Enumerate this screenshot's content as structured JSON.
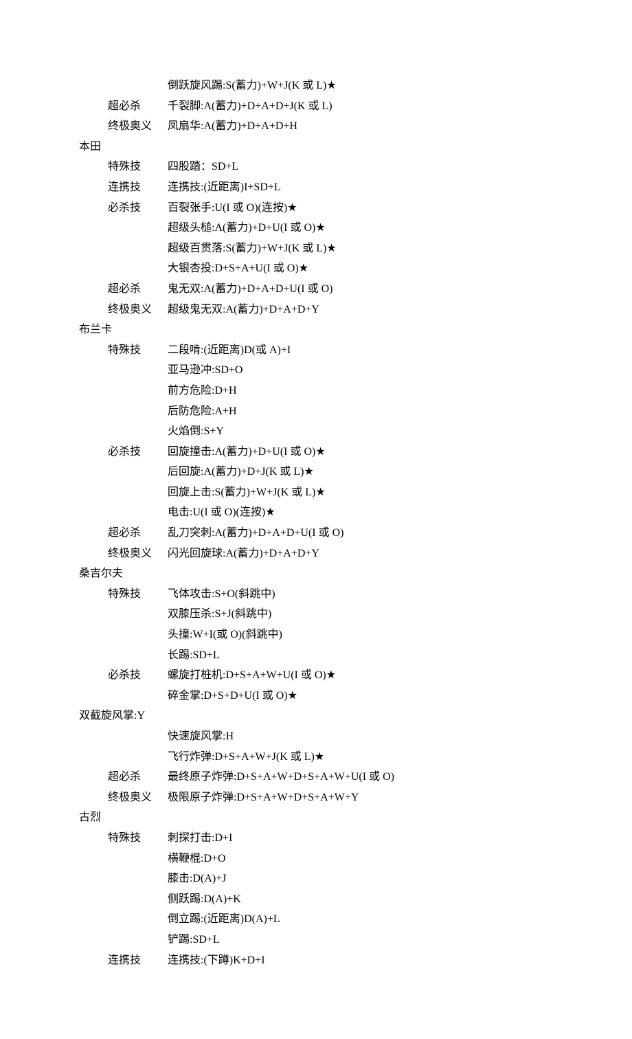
{
  "top_rows": [
    {
      "cat": "",
      "move": "倒跃旋风踢:S(蓄力)+W+J(K 或 L)★"
    },
    {
      "cat": "超必杀",
      "move": "千裂脚:A(蓄力)+D+A+D+J(K 或 L)"
    },
    {
      "cat": "终极奥义",
      "move": "凤扇华:A(蓄力)+D+A+D+H"
    }
  ],
  "characters": [
    {
      "name": "本田",
      "rows": [
        {
          "cat": "特殊技",
          "move": "四股踏：SD+L"
        },
        {
          "cat": "连携技",
          "move": "连携技:(近距离)I+SD+L"
        },
        {
          "cat": "必杀技",
          "move": "百裂张手:U(I 或 O)(连按)★"
        },
        {
          "cat": "",
          "move": "超级头槌:A(蓄力)+D+U(I 或 O)★"
        },
        {
          "cat": "",
          "move": "超级百贯落:S(蓄力)+W+J(K 或 L)★"
        },
        {
          "cat": "",
          "move": "大银杏投:D+S+A+U(I 或 O)★"
        },
        {
          "cat": "超必杀",
          "move": "鬼无双:A(蓄力)+D+A+D+U(I 或 O)"
        },
        {
          "cat": "终极奥义",
          "move": "超级鬼无双:A(蓄力)+D+A+D+Y"
        }
      ]
    },
    {
      "name": "布兰卡",
      "rows": [
        {
          "cat": "特殊技",
          "move": "二段啃:(近距离)D(或 A)+I"
        },
        {
          "cat": "",
          "move": "亚马逊冲:SD+O"
        },
        {
          "cat": "",
          "move": "前方危险:D+H"
        },
        {
          "cat": "",
          "move": "后防危险:A+H"
        },
        {
          "cat": "",
          "move": "火焰倒:S+Y"
        },
        {
          "cat": "必杀技",
          "move": "回旋撞击:A(蓄力)+D+U(I 或 O)★"
        },
        {
          "cat": "",
          "move": "后回旋:A(蓄力)+D+J(K 或 L)★"
        },
        {
          "cat": "",
          "move": "回旋上击:S(蓄力)+W+J(K 或 L)★"
        },
        {
          "cat": "",
          "move": "电击:U(I 或 O)(连按)★"
        },
        {
          "cat": "超必杀",
          "move": "乱刀突刺:A(蓄力)+D+A+D+U(I 或 O)"
        },
        {
          "cat": "终极奥义",
          "move": "闪光回旋球:A(蓄力)+D+A+D+Y"
        }
      ]
    },
    {
      "name": "桑吉尔夫",
      "rows": [
        {
          "cat": "特殊技",
          "move": "飞体攻击:S+O(斜跳中)"
        },
        {
          "cat": "",
          "move": "双膝压杀:S+J(斜跳中)"
        },
        {
          "cat": "",
          "move": "头撞:W+I(或 O)(斜跳中)"
        },
        {
          "cat": "",
          "move": "长踢:SD+L"
        },
        {
          "cat": "必杀技",
          "move": "螺旋打桩机:D+S+A+W+U(I 或 O)★"
        },
        {
          "cat": "",
          "move": "碎金掌:D+S+D+U(I 或 O)★"
        },
        {
          "cat": "outdent",
          "move": "双截旋风掌:Y"
        },
        {
          "cat": "",
          "move": "快速旋风掌:H"
        },
        {
          "cat": "",
          "move": "飞行炸弹:D+S+A+W+J(K 或 L)★"
        },
        {
          "cat": "超必杀",
          "move": "最终原子炸弹:D+S+A+W+D+S+A+W+U(I 或 O)"
        },
        {
          "cat": "终极奥义",
          "move": "极限原子炸弹:D+S+A+W+D+S+A+W+Y"
        }
      ]
    },
    {
      "name": "古烈",
      "rows": [
        {
          "cat": "特殊技",
          "move": "刺探打击:D+I"
        },
        {
          "cat": "",
          "move": "横鞭棍:D+O"
        },
        {
          "cat": "",
          "move": "膝击:D(A)+J"
        },
        {
          "cat": "",
          "move": "侧跃踢:D(A)+K"
        },
        {
          "cat": "",
          "move": "倒立踢:(近距离)D(A)+L"
        },
        {
          "cat": "",
          "move": "铲踢:SD+L"
        },
        {
          "cat": "连携技",
          "move": "连携技:(下蹲)K+D+I"
        }
      ]
    }
  ]
}
